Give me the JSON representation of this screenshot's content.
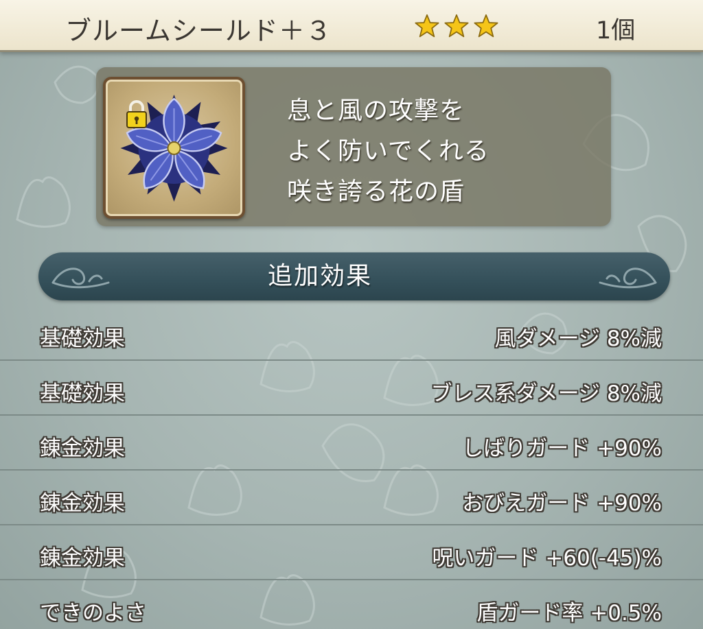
{
  "item": {
    "name": "ブルームシールド＋３",
    "rarity_stars": 3,
    "quantity": "1個",
    "icon": "bloom-shield-icon",
    "locked": true
  },
  "description": {
    "lines": [
      "息と風の攻撃を",
      "よく防いでくれる",
      "咲き誇る花の盾"
    ]
  },
  "section": {
    "title": "追加効果"
  },
  "effects": [
    {
      "label": "基礎効果",
      "value": "風ダメージ  8%減"
    },
    {
      "label": "基礎効果",
      "value": "ブレス系ダメージ  8%減"
    },
    {
      "label": "錬金効果",
      "value": "しばりガード  +90%"
    },
    {
      "label": "錬金効果",
      "value": "おびえガード  +90%"
    },
    {
      "label": "錬金効果",
      "value": "呪いガード  +60(-45)%"
    },
    {
      "label": "できのよさ",
      "value": "盾ガード率  +0.5%"
    }
  ],
  "colors": {
    "header_bg": "#f3eedc",
    "banner_bg": "#34505a",
    "panel_bg": "#767360",
    "star": "#f5c518",
    "background": "#a6b5b2"
  }
}
